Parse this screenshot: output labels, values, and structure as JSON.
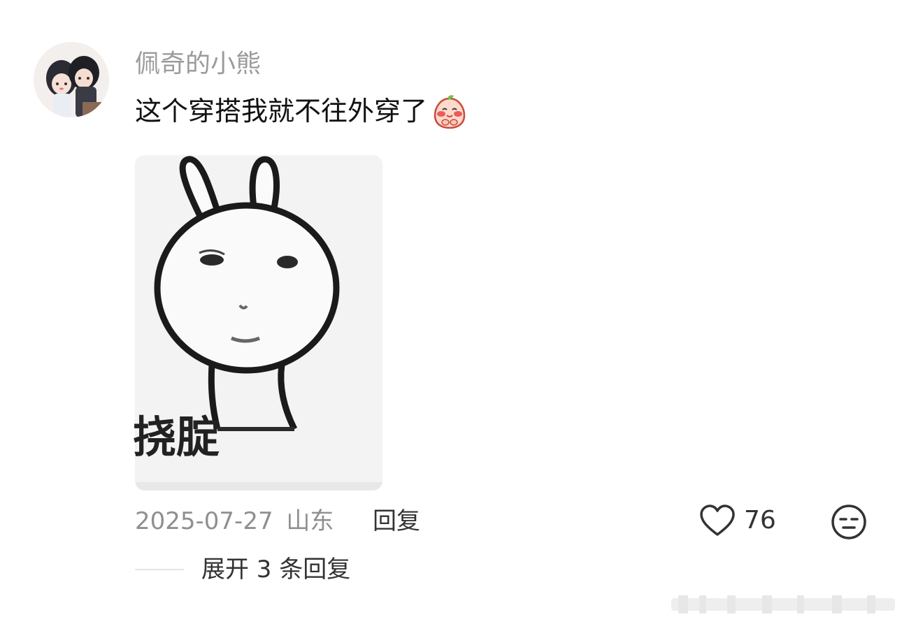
{
  "comment": {
    "username": "佩奇的小熊",
    "text": "这个穿搭我就不往外穿了",
    "emoji_icon": "shy-peach-emoji-icon",
    "sticker": {
      "caption": "挠腚",
      "icon": "bunny-sticker-image"
    },
    "date": "2025-07-27",
    "location": "山东",
    "reply_label": "回复",
    "like_count": "76",
    "like_icon": "heart-outline-icon",
    "dislike_icon": "meh-face-icon",
    "expand_label": "展开 3 条回复"
  },
  "colors": {
    "username": "#9b9b9b",
    "text": "#111111",
    "meta": "#8f8f8f",
    "action": "#333333"
  }
}
